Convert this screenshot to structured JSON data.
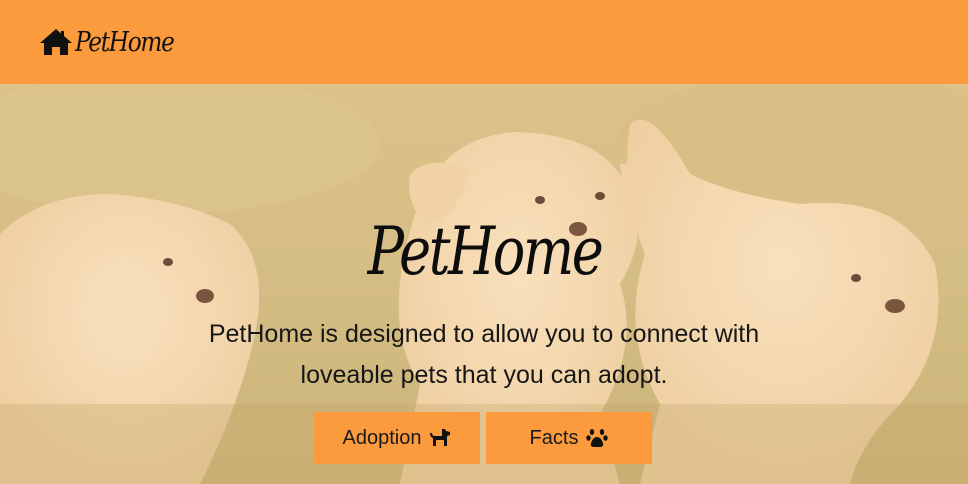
{
  "navbar": {
    "brand_icon": "house-icon",
    "brand_text": "PetHome",
    "color": "#fc9a3e"
  },
  "hero": {
    "background": "puppies-photo",
    "title": "PetHome",
    "description": "PetHome is designed to allow you to connect with loveable pets that you can adopt.",
    "buttons": [
      {
        "label": "Adoption",
        "icon": "dog-icon"
      },
      {
        "label": "Facts",
        "icon": "paw-icon"
      }
    ]
  }
}
